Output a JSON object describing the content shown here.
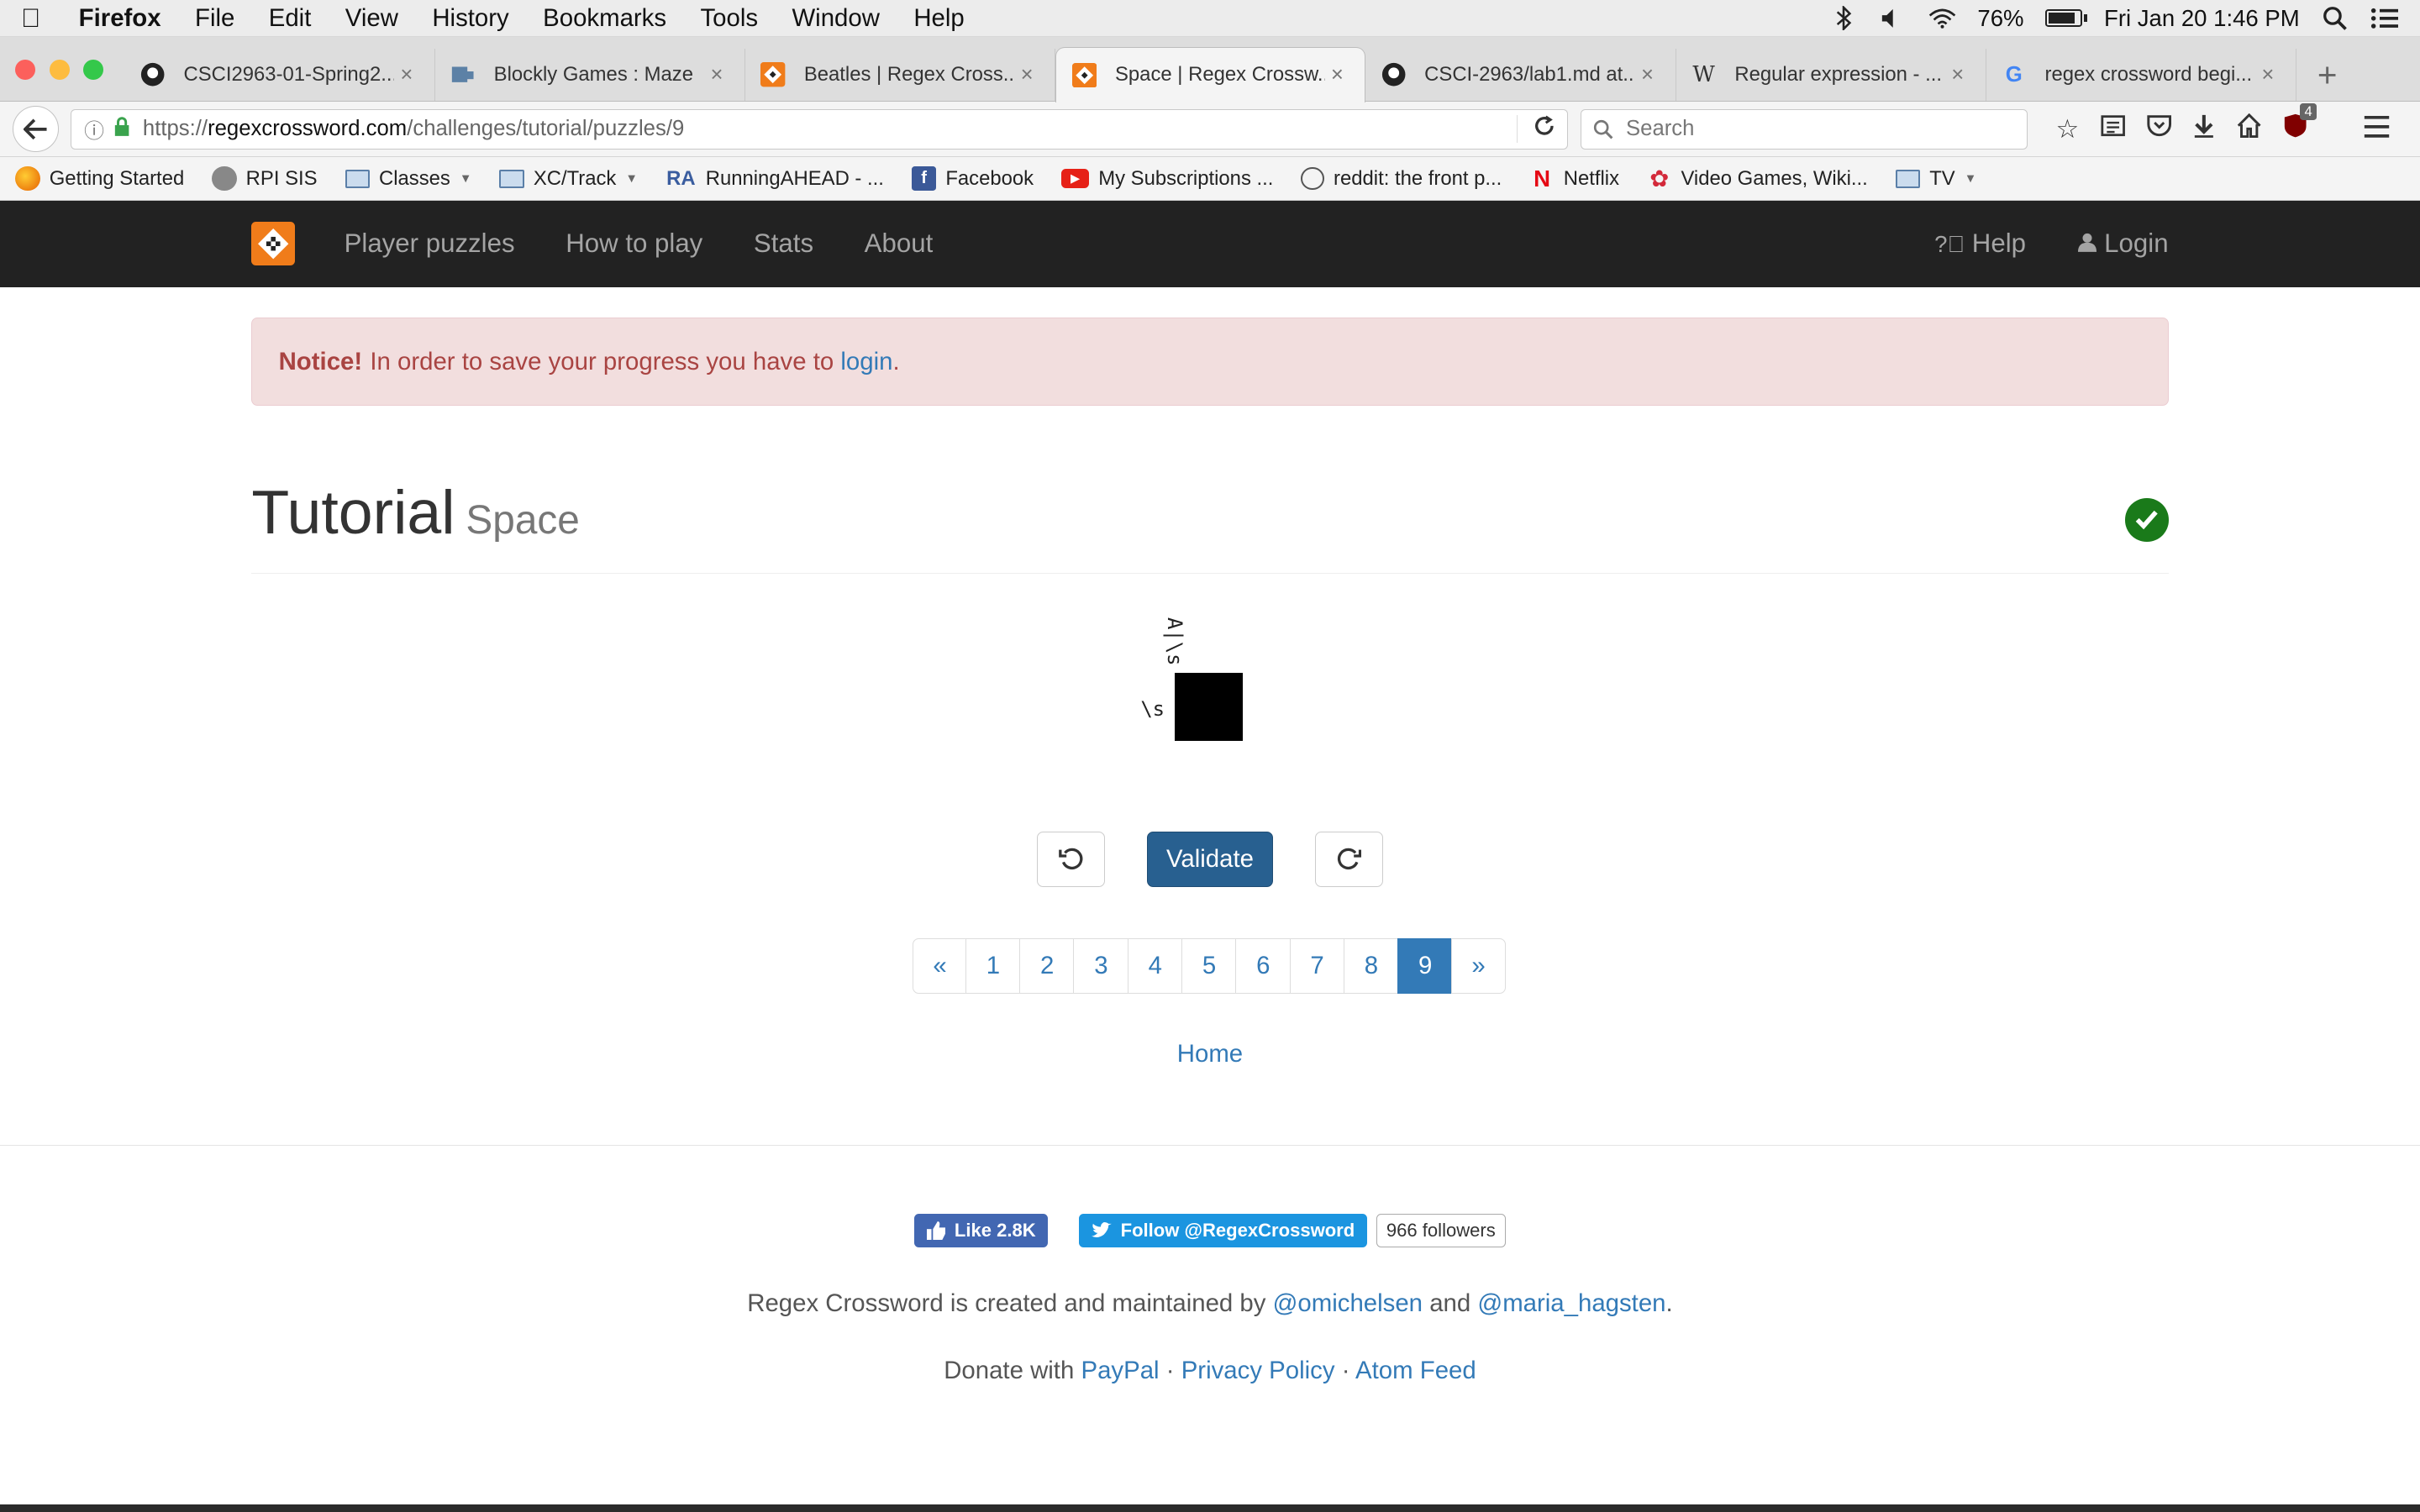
{
  "menubar": {
    "app": "Firefox",
    "items": [
      "File",
      "Edit",
      "View",
      "History",
      "Bookmarks",
      "Tools",
      "Window",
      "Help"
    ],
    "battery_pct": "76%",
    "battery_level": 0.76,
    "datetime": "Fri Jan 20  1:46 PM"
  },
  "tabs": [
    {
      "label": "CSCI2963-01-Spring2...",
      "icon": "github-icon"
    },
    {
      "label": "Blockly Games : Maze",
      "icon": "puzzle-icon"
    },
    {
      "label": "Beatles | Regex Cross...",
      "icon": "regex-icon"
    },
    {
      "label": "Space | Regex Crossw...",
      "icon": "regex-icon",
      "active": true
    },
    {
      "label": "CSCI-2963/lab1.md at...",
      "icon": "github-icon"
    },
    {
      "label": "Regular expression - ...",
      "icon": "wikipedia-icon"
    },
    {
      "label": "regex crossword begi...",
      "icon": "google-icon"
    }
  ],
  "navbar": {
    "url_prefix": "https://",
    "url_host": "regexcrossword.com",
    "url_path": "/challenges/tutorial/puzzles/9",
    "search_placeholder": "Search",
    "ublock_count": "4"
  },
  "bookmarks": [
    {
      "label": "Getting Started",
      "icon": "firefox-icon"
    },
    {
      "label": "RPI SIS",
      "icon": "globe-icon"
    },
    {
      "label": "Classes",
      "icon": "folder-icon",
      "dropdown": true
    },
    {
      "label": "XC/Track",
      "icon": "folder-icon",
      "dropdown": true
    },
    {
      "label": "RunningAHEAD - ...",
      "icon": "ra-icon",
      "icon_text": "RA"
    },
    {
      "label": "Facebook",
      "icon": "facebook-icon"
    },
    {
      "label": "My Subscriptions ...",
      "icon": "youtube-icon"
    },
    {
      "label": "reddit: the front p...",
      "icon": "reddit-icon"
    },
    {
      "label": "Netflix",
      "icon": "netflix-icon"
    },
    {
      "label": "Video Games, Wiki...",
      "icon": "gamepad-icon"
    },
    {
      "label": "TV",
      "icon": "folder-icon",
      "dropdown": true
    }
  ],
  "site": {
    "nav": [
      "Player puzzles",
      "How to play",
      "Stats",
      "About"
    ],
    "help": "Help",
    "login": "Login"
  },
  "alert": {
    "strong": "Notice!",
    "text": "In order to save your progress you have to",
    "link": "login",
    "end": "."
  },
  "header": {
    "title": "Tutorial",
    "subtitle": "Space"
  },
  "puzzle": {
    "column_clue": "A|\\s",
    "row_clue": "\\s"
  },
  "controls": {
    "validate": "Validate"
  },
  "pager": {
    "prev": "«",
    "pages": [
      "1",
      "2",
      "3",
      "4",
      "5",
      "6",
      "7",
      "8",
      "9"
    ],
    "active": "9",
    "next": "»"
  },
  "home_link": "Home",
  "footer": {
    "fb_like": "Like 2.8K",
    "tw_follow": "Follow @RegexCrossword",
    "tw_count": "966 followers",
    "credits_pre": "Regex Crossword is created and maintained by",
    "author1": "@omichelsen",
    "and": "and",
    "author2": "@maria_hagsten",
    "credits_end": ".",
    "donate": "Donate with",
    "paypal": "PayPal",
    "sep": "·",
    "privacy": "Privacy Policy",
    "atom": "Atom Feed"
  },
  "colors": {
    "site_nav_bg": "#222222",
    "logo_orange": "#f07c1a",
    "primary": "#337ab7",
    "validate_bg": "#286090",
    "alert_bg": "#f2dede",
    "alert_text": "#a94442",
    "success": "#1a7a1a"
  }
}
